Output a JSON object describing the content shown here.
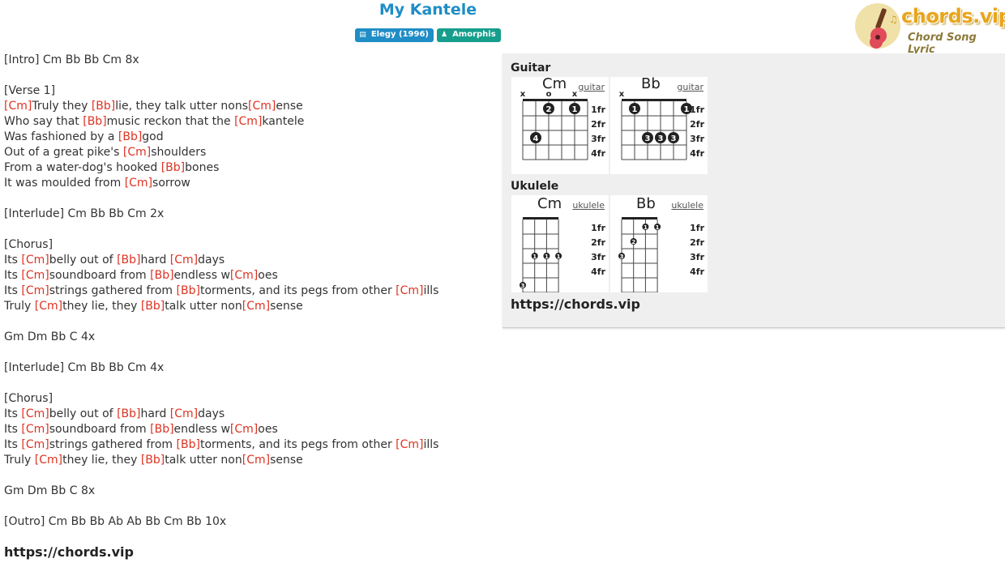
{
  "song": {
    "title": "My Kantele"
  },
  "badges": {
    "album": "Elegy (1996)",
    "artist": "Amorphis"
  },
  "logo": {
    "brand": "chords.vip",
    "subtitle": "Chord Song Lyric"
  },
  "lyrics": [
    [
      {
        "t": "[Intro] Cm Bb Bb Cm 8x"
      }
    ],
    [],
    [
      {
        "t": "[Verse 1]"
      }
    ],
    [
      {
        "c": "[Cm]"
      },
      {
        "t": "Truly they "
      },
      {
        "c": "[Bb]"
      },
      {
        "t": "lie, they talk utter nons"
      },
      {
        "c": "[Cm]"
      },
      {
        "t": "ense"
      }
    ],
    [
      {
        "t": "Who say that "
      },
      {
        "c": "[Bb]"
      },
      {
        "t": "music reckon that the "
      },
      {
        "c": "[Cm]"
      },
      {
        "t": "kantele"
      }
    ],
    [
      {
        "t": "Was fashioned by a "
      },
      {
        "c": "[Bb]"
      },
      {
        "t": "god"
      }
    ],
    [
      {
        "t": "Out of a great pike's "
      },
      {
        "c": "[Cm]"
      },
      {
        "t": "shoulders"
      }
    ],
    [
      {
        "t": "From a water-dog's hooked "
      },
      {
        "c": "[Bb]"
      },
      {
        "t": "bones"
      }
    ],
    [
      {
        "t": "It was moulded from "
      },
      {
        "c": "[Cm]"
      },
      {
        "t": "sorrow"
      }
    ],
    [],
    [
      {
        "t": "[Interlude] Cm Bb Bb Cm 2x"
      }
    ],
    [],
    [
      {
        "t": "[Chorus]"
      }
    ],
    [
      {
        "t": "Its "
      },
      {
        "c": "[Cm]"
      },
      {
        "t": "belly out of "
      },
      {
        "c": "[Bb]"
      },
      {
        "t": "hard "
      },
      {
        "c": "[Cm]"
      },
      {
        "t": "days"
      }
    ],
    [
      {
        "t": "Its "
      },
      {
        "c": "[Cm]"
      },
      {
        "t": "soundboard from "
      },
      {
        "c": "[Bb]"
      },
      {
        "t": "endless w"
      },
      {
        "c": "[Cm]"
      },
      {
        "t": "oes"
      }
    ],
    [
      {
        "t": "Its "
      },
      {
        "c": "[Cm]"
      },
      {
        "t": "strings gathered from "
      },
      {
        "c": "[Bb]"
      },
      {
        "t": "torments, and its pegs from other "
      },
      {
        "c": "[Cm]"
      },
      {
        "t": "ills"
      }
    ],
    [
      {
        "t": "Truly "
      },
      {
        "c": "[Cm]"
      },
      {
        "t": "they lie, they "
      },
      {
        "c": "[Bb]"
      },
      {
        "t": "talk utter non"
      },
      {
        "c": "[Cm]"
      },
      {
        "t": "sense"
      }
    ],
    [],
    [
      {
        "t": "Gm Dm Bb C 4x"
      }
    ],
    [],
    [
      {
        "t": "[Interlude] Cm Bb Bb Cm 4x"
      }
    ],
    [],
    [
      {
        "t": "[Chorus]"
      }
    ],
    [
      {
        "t": "Its "
      },
      {
        "c": "[Cm]"
      },
      {
        "t": "belly out of "
      },
      {
        "c": "[Bb]"
      },
      {
        "t": "hard "
      },
      {
        "c": "[Cm]"
      },
      {
        "t": "days"
      }
    ],
    [
      {
        "t": "Its "
      },
      {
        "c": "[Cm]"
      },
      {
        "t": "soundboard from "
      },
      {
        "c": "[Bb]"
      },
      {
        "t": "endless w"
      },
      {
        "c": "[Cm]"
      },
      {
        "t": "oes"
      }
    ],
    [
      {
        "t": "Its "
      },
      {
        "c": "[Cm]"
      },
      {
        "t": "strings gathered from "
      },
      {
        "c": "[Bb]"
      },
      {
        "t": "torments, and its pegs from other "
      },
      {
        "c": "[Cm]"
      },
      {
        "t": "ills"
      }
    ],
    [
      {
        "t": "Truly "
      },
      {
        "c": "[Cm]"
      },
      {
        "t": "they lie, they "
      },
      {
        "c": "[Bb]"
      },
      {
        "t": "talk utter non"
      },
      {
        "c": "[Cm]"
      },
      {
        "t": "sense"
      }
    ],
    [],
    [
      {
        "t": "Gm Dm Bb C 8x"
      }
    ],
    [],
    [
      {
        "t": "[Outro] Cm Bb Bb Ab Ab Bb Cm Bb 10x"
      }
    ]
  ],
  "footer_url": "https://chords.vip",
  "panel": {
    "guitar_title": "Guitar",
    "ukulele_title": "Ukulele",
    "url": "https://chords.vip",
    "fret_labels": [
      "1fr",
      "2fr",
      "3fr",
      "4fr"
    ],
    "guitar": [
      {
        "name": "Cm",
        "link": "guitar",
        "markers": [
          "x",
          "",
          "o",
          "",
          "x",
          ""
        ],
        "dots": [
          {
            "string": 3,
            "fret": 1,
            "finger": "2"
          },
          {
            "string": 5,
            "fret": 1,
            "finger": "1"
          },
          {
            "string": 2,
            "fret": 3,
            "finger": "4"
          }
        ]
      },
      {
        "name": "Bb",
        "link": "guitar",
        "markers": [
          "x",
          "",
          "",
          "",
          "",
          ""
        ],
        "dots": [
          {
            "string": 2,
            "fret": 1,
            "finger": "1"
          },
          {
            "string": 6,
            "fret": 1,
            "finger": "1"
          },
          {
            "string": 3,
            "fret": 3,
            "finger": "3"
          },
          {
            "string": 4,
            "fret": 3,
            "finger": "3"
          },
          {
            "string": 5,
            "fret": 3,
            "finger": "3"
          }
        ]
      }
    ],
    "ukulele": [
      {
        "name": "Cm",
        "link": "ukulele",
        "dots": [
          {
            "string": 2,
            "fret": 3,
            "finger": "1"
          },
          {
            "string": 3,
            "fret": 3,
            "finger": "1"
          },
          {
            "string": 4,
            "fret": 3,
            "finger": "1"
          },
          {
            "string": 1,
            "fret": 5,
            "finger": "3"
          }
        ]
      },
      {
        "name": "Bb",
        "link": "ukulele",
        "dots": [
          {
            "string": 3,
            "fret": 1,
            "finger": "1"
          },
          {
            "string": 4,
            "fret": 1,
            "finger": "1"
          },
          {
            "string": 2,
            "fret": 2,
            "finger": "2"
          },
          {
            "string": 1,
            "fret": 3,
            "finger": "3"
          }
        ]
      }
    ]
  },
  "colors": {
    "title": "#1f8dc6",
    "chord": "#dd3322",
    "album_badge": "#1f8dc6",
    "artist_badge": "#169e8c",
    "logo": "#e8a51c"
  }
}
